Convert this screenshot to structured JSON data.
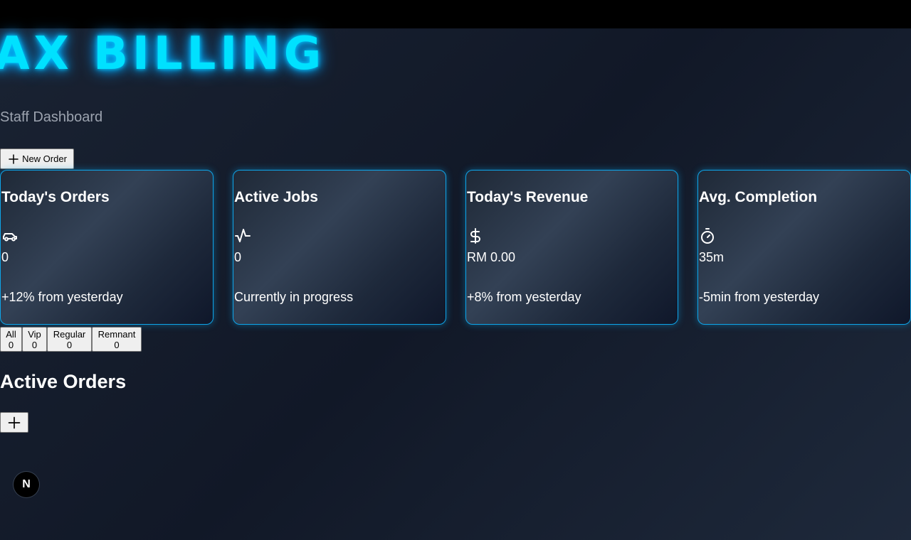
{
  "header": {
    "brand": "AX BILLING",
    "subtitle": "Staff Dashboard",
    "new_order_label": "New Order"
  },
  "stats": [
    {
      "title": "Today's Orders",
      "icon": "car-icon",
      "value": "0",
      "note": "+12% from yesterday"
    },
    {
      "title": "Active Jobs",
      "icon": "activity-icon",
      "value": "0",
      "note": "Currently in progress"
    },
    {
      "title": "Today's Revenue",
      "icon": "dollar-icon",
      "value": "RM 0.00",
      "note": "+8% from yesterday"
    },
    {
      "title": "Avg. Completion",
      "icon": "timer-icon",
      "value": "35m",
      "note": "-5min from yesterday"
    }
  ],
  "filters": [
    {
      "label": "All",
      "count": "0"
    },
    {
      "label": "Vip",
      "count": "0"
    },
    {
      "label": "Regular",
      "count": "0"
    },
    {
      "label": "Remnant",
      "count": "0"
    }
  ],
  "active_orders": {
    "title": "Active Orders"
  },
  "dev_badge": {
    "label": "N"
  },
  "colors": {
    "accent": "#00e1ff",
    "card_border": "#0ea5e9",
    "background": "#111827",
    "topbar": "#000000"
  }
}
